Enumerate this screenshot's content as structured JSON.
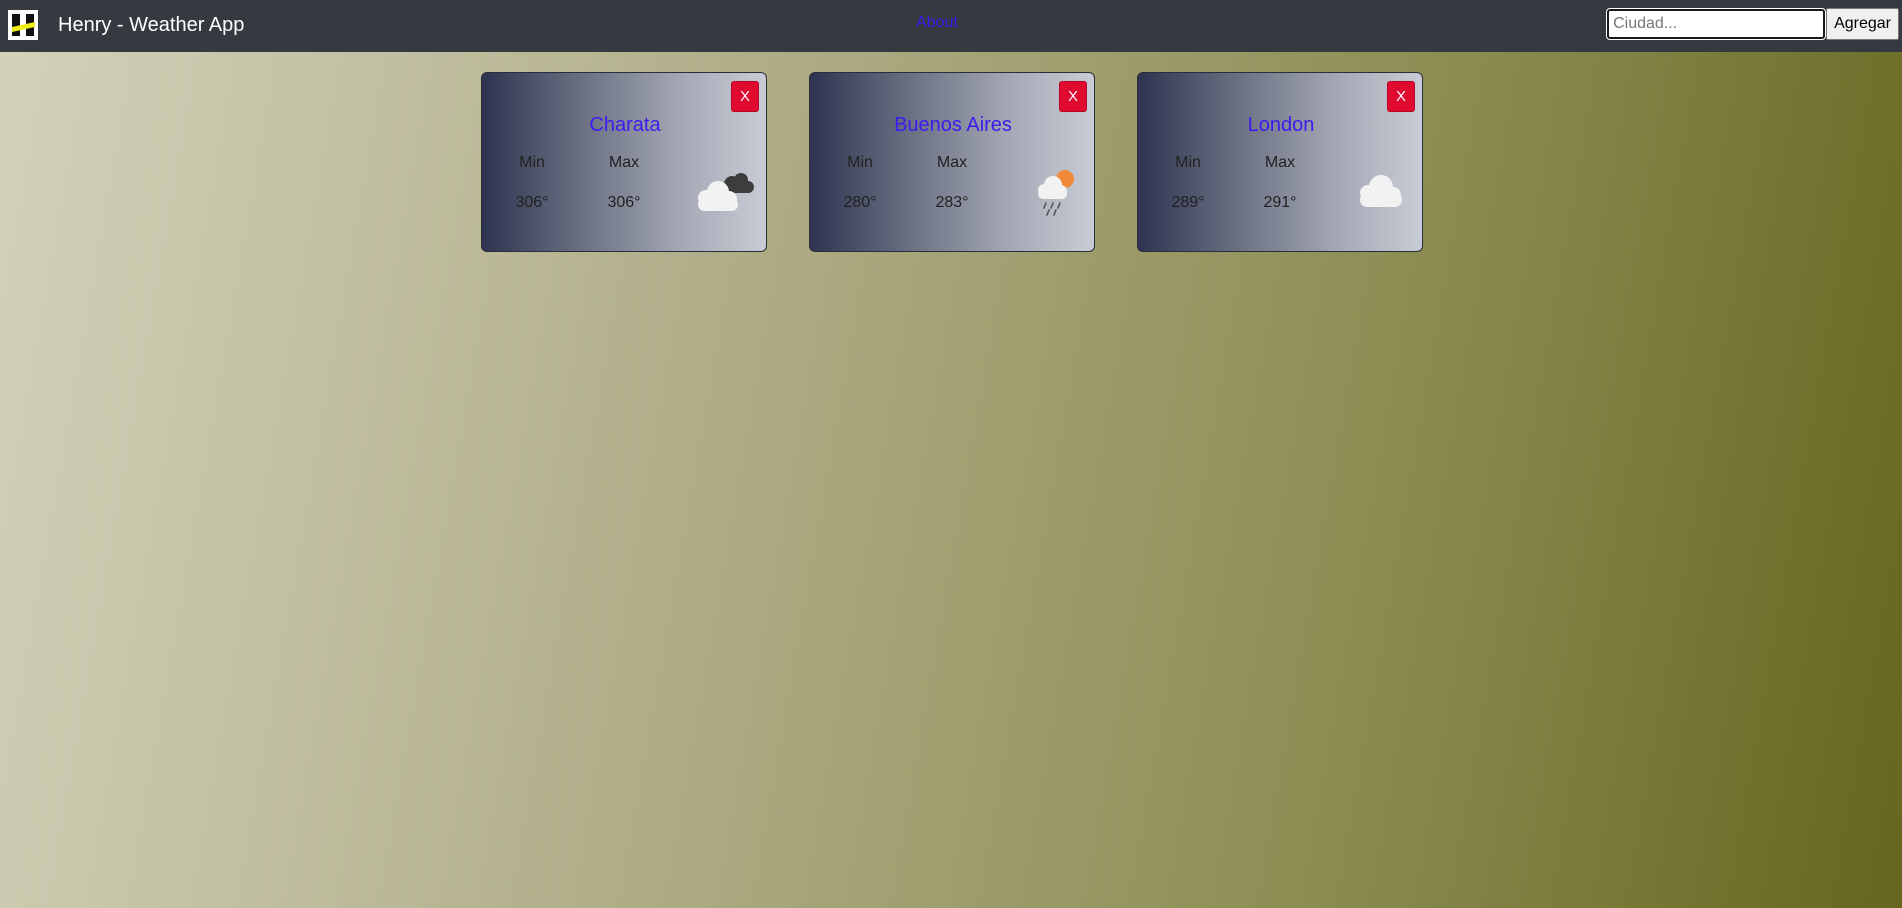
{
  "navbar": {
    "title": "Henry - Weather App",
    "about_label": "About",
    "search": {
      "placeholder": "Ciudad...",
      "value": ""
    },
    "add_button_label": "Agregar",
    "logo_icon": "henry-logo-icon"
  },
  "labels": {
    "min": "Min",
    "max": "Max"
  },
  "cards": [
    {
      "city": "Charata",
      "min": "306°",
      "max": "306°",
      "icon": "dark-rain-clouds-icon",
      "close_label": "X"
    },
    {
      "city": "Buenos Aires",
      "min": "280°",
      "max": "283°",
      "icon": "sun-cloud-rain-icon",
      "close_label": "X"
    },
    {
      "city": "London",
      "min": "289°",
      "max": "291°",
      "icon": "cloud-icon",
      "close_label": "X"
    }
  ],
  "colors": {
    "navbar_bg": "#343a40",
    "link": "#3a1cf0",
    "close_button": "#e0092f"
  }
}
